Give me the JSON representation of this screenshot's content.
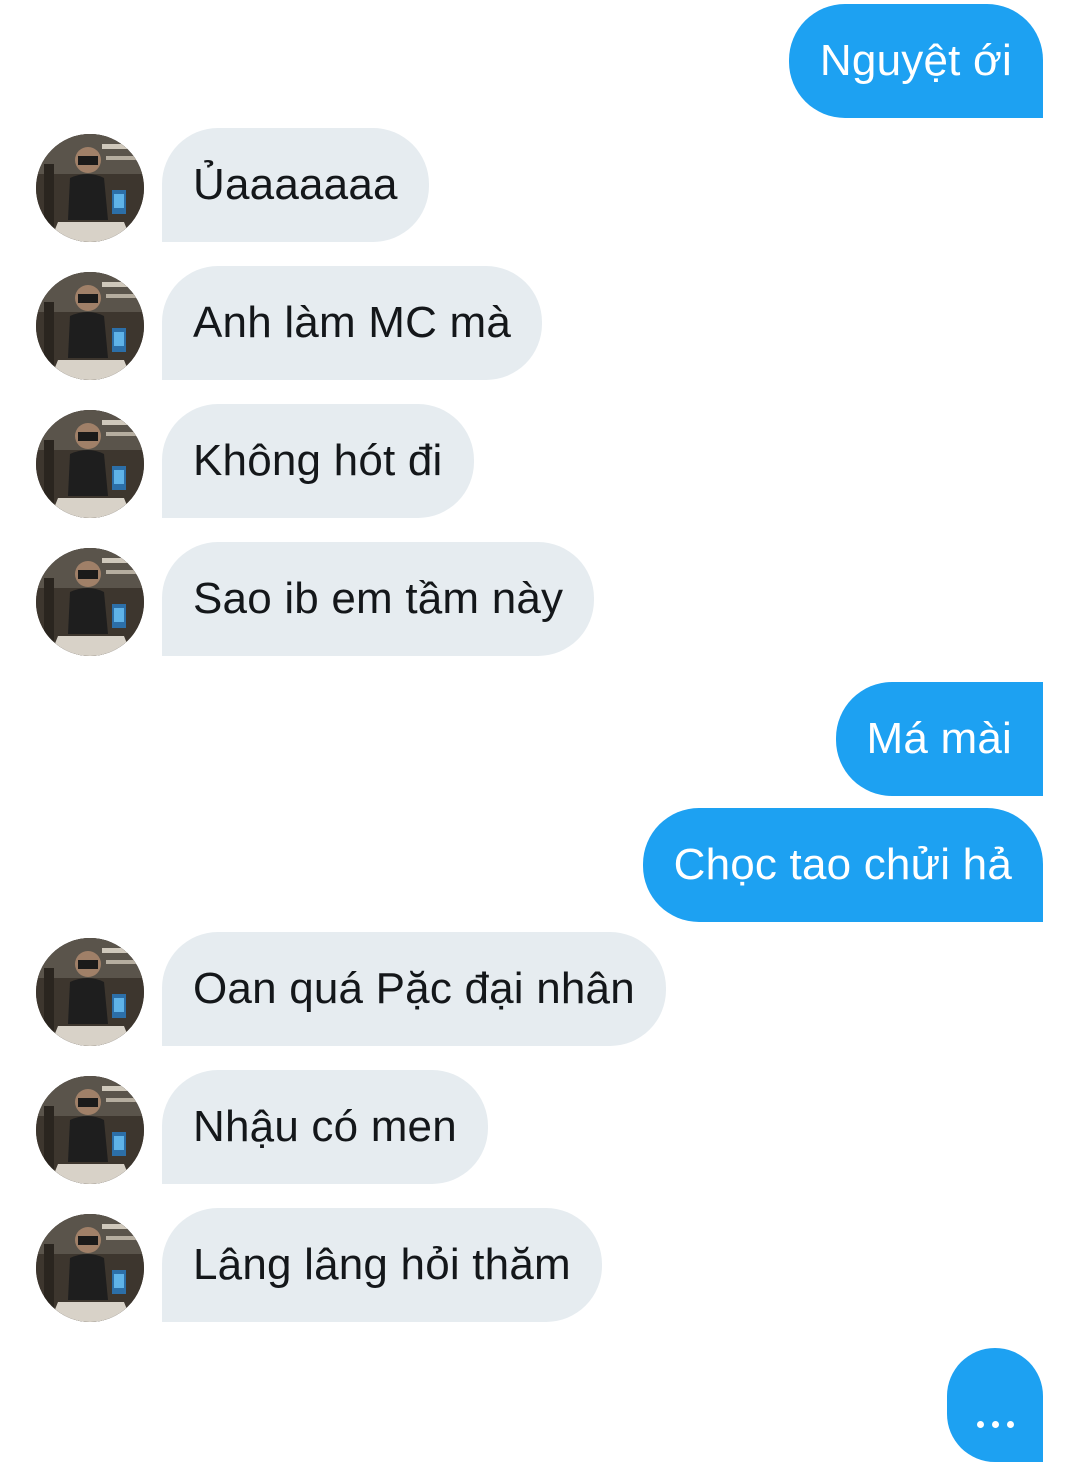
{
  "conversation": {
    "messages": [
      {
        "direction": "outgoing",
        "text": "Nguyệt ới"
      },
      {
        "direction": "incoming",
        "text": "Ủaaaaaaa"
      },
      {
        "direction": "incoming",
        "text": "Anh làm MC mà"
      },
      {
        "direction": "incoming",
        "text": "Không hót đi"
      },
      {
        "direction": "incoming",
        "text": "Sao ib em tầm này"
      },
      {
        "direction": "outgoing",
        "text": "Má mài"
      },
      {
        "direction": "outgoing",
        "text": "Chọc tao chửi hả"
      },
      {
        "direction": "incoming",
        "text": "Oan quá Pặc đại nhân"
      },
      {
        "direction": "incoming",
        "text": "Nhậu có men"
      },
      {
        "direction": "incoming",
        "text": "Lâng lâng hỏi thăm"
      }
    ],
    "typing_indicator": {
      "visible": true,
      "direction": "outgoing"
    }
  },
  "colors": {
    "outgoing_bubble": "#1da1f2",
    "incoming_bubble": "#e6ecf0",
    "outgoing_text": "#ffffff",
    "incoming_text": "#14171a",
    "background": "#ffffff"
  },
  "icons": {
    "avatar": "contact-avatar-photo",
    "typing": "typing-dots-icon"
  }
}
